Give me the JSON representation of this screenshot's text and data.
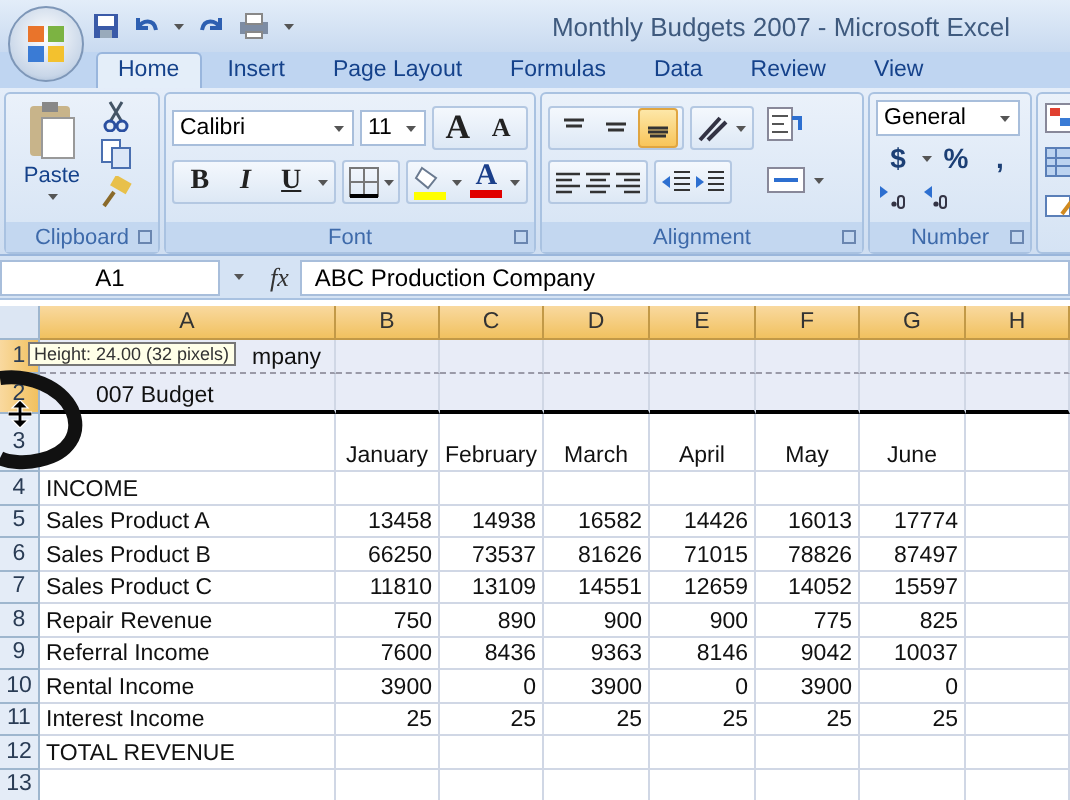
{
  "window": {
    "title": "Monthly Budgets 2007 - Microsoft Excel"
  },
  "tabs": [
    {
      "label": "Home",
      "selected": true
    },
    {
      "label": "Insert",
      "selected": false
    },
    {
      "label": "Page Layout",
      "selected": false
    },
    {
      "label": "Formulas",
      "selected": false
    },
    {
      "label": "Data",
      "selected": false
    },
    {
      "label": "Review",
      "selected": false
    },
    {
      "label": "View",
      "selected": false
    }
  ],
  "ribbon": {
    "clipboard": {
      "label": "Clipboard",
      "paste": "Paste"
    },
    "font": {
      "label": "Font",
      "font_name": "Calibri",
      "font_size": "11",
      "grow": "A",
      "shrink": "A",
      "bold": "B",
      "italic": "I",
      "underline": "U",
      "font_color": "A"
    },
    "alignment": {
      "label": "Alignment",
      "vertical": [
        {
          "selected": false
        },
        {
          "selected": false
        },
        {
          "selected": true
        }
      ]
    },
    "number": {
      "label": "Number",
      "format": "General",
      "currency": "$",
      "percent": "%",
      "comma": ","
    }
  },
  "formula_bar": {
    "name_box": "A1",
    "fx": "fx",
    "formula": "ABC Production Company"
  },
  "tooltip": "Height: 24.00 (32 pixels)",
  "columns": [
    {
      "label": "A",
      "selected": true
    },
    {
      "label": "B",
      "selected": true
    },
    {
      "label": "C",
      "selected": true
    },
    {
      "label": "D",
      "selected": true
    },
    {
      "label": "E",
      "selected": true
    },
    {
      "label": "F",
      "selected": true
    },
    {
      "label": "G",
      "selected": true
    },
    {
      "label": "H",
      "selected": true
    }
  ],
  "rows": [
    {
      "header": "1",
      "selected": true,
      "kind": "label",
      "label": "mpany"
    },
    {
      "header": "2",
      "selected": true,
      "kind": "label",
      "label": "007 Budget"
    },
    {
      "header": "3",
      "selected": false,
      "kind": "months",
      "values": [
        "January",
        "February",
        "March",
        "April",
        "May",
        "June"
      ]
    },
    {
      "header": "4",
      "selected": false,
      "kind": "label",
      "label": "INCOME"
    },
    {
      "header": "5",
      "selected": false,
      "kind": "figures",
      "label": "Sales Product A",
      "values": [
        "13458",
        "14938",
        "16582",
        "14426",
        "16013",
        "17774"
      ]
    },
    {
      "header": "6",
      "selected": false,
      "kind": "figures",
      "label": "Sales Product B",
      "values": [
        "66250",
        "73537",
        "81626",
        "71015",
        "78826",
        "87497"
      ]
    },
    {
      "header": "7",
      "selected": false,
      "kind": "figures",
      "label": "Sales Product C",
      "values": [
        "11810",
        "13109",
        "14551",
        "12659",
        "14052",
        "15597"
      ]
    },
    {
      "header": "8",
      "selected": false,
      "kind": "figures",
      "label": "Repair Revenue",
      "values": [
        "750",
        "890",
        "900",
        "900",
        "775",
        "825"
      ]
    },
    {
      "header": "9",
      "selected": false,
      "kind": "figures",
      "label": "Referral Income",
      "values": [
        "7600",
        "8436",
        "9363",
        "8146",
        "9042",
        "10037"
      ]
    },
    {
      "header": "10",
      "selected": false,
      "kind": "figures",
      "label": "Rental Income",
      "values": [
        "3900",
        "0",
        "3900",
        "0",
        "3900",
        "0"
      ]
    },
    {
      "header": "11",
      "selected": false,
      "kind": "figures",
      "label": "Interest Income",
      "values": [
        "25",
        "25",
        "25",
        "25",
        "25",
        "25"
      ]
    },
    {
      "header": "12",
      "selected": false,
      "kind": "label",
      "label": "TOTAL REVENUE"
    },
    {
      "header": "13",
      "selected": false,
      "kind": "label"
    }
  ]
}
